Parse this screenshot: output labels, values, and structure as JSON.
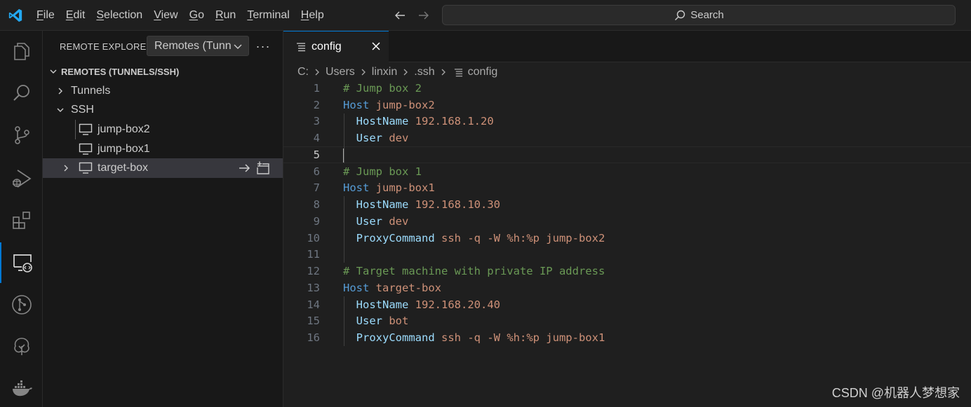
{
  "menu": {
    "items": [
      "File",
      "Edit",
      "Selection",
      "View",
      "Go",
      "Run",
      "Terminal",
      "Help"
    ],
    "mnemonics": [
      "F",
      "E",
      "S",
      "V",
      "G",
      "R",
      "T",
      "H"
    ]
  },
  "search": {
    "label": "Search"
  },
  "activity": {
    "items": [
      "explorer-icon",
      "search-icon",
      "source-control-icon",
      "run-debug-icon",
      "extensions-icon",
      "remote-explorer-icon",
      "git-graph-icon",
      "tree-icon",
      "docker-icon"
    ],
    "active": "remote-explorer-icon",
    "accent": "#0078d4"
  },
  "sidebar": {
    "title": "REMOTE EXPLORER",
    "select_value": "Remotes (Tunnels/SSH)",
    "more": "···",
    "section": "REMOTES (TUNNELS/SSH)",
    "tree": [
      {
        "label": "Tunnels",
        "level": 1,
        "expanded": false
      },
      {
        "label": "SSH",
        "level": 1,
        "expanded": true
      },
      {
        "label": "jump-box2",
        "level": 2
      },
      {
        "label": "jump-box1",
        "level": 2
      },
      {
        "label": "target-box",
        "level": 2,
        "selected": true
      }
    ]
  },
  "editor": {
    "tab": {
      "label": "config"
    },
    "breadcrumb": [
      "C:",
      "Users",
      "linxin",
      ".ssh",
      "config"
    ],
    "current_line": 5,
    "lines": [
      {
        "n": "1",
        "parts": [
          {
            "t": "# Jump box 2",
            "c": "c"
          }
        ]
      },
      {
        "n": "2",
        "parts": [
          {
            "t": "Host",
            "c": "h"
          },
          {
            "t": " "
          },
          {
            "t": "jump-box2",
            "c": "v"
          }
        ]
      },
      {
        "n": "3",
        "parts": [
          {
            "t": "  "
          },
          {
            "t": "HostName",
            "c": "k"
          },
          {
            "t": " "
          },
          {
            "t": "192.168.1.20",
            "c": "v"
          }
        ]
      },
      {
        "n": "4",
        "parts": [
          {
            "t": "  "
          },
          {
            "t": "User",
            "c": "k"
          },
          {
            "t": " "
          },
          {
            "t": "dev",
            "c": "v"
          }
        ]
      },
      {
        "n": "5",
        "parts": []
      },
      {
        "n": "6",
        "parts": [
          {
            "t": "# Jump box 1",
            "c": "c"
          }
        ]
      },
      {
        "n": "7",
        "parts": [
          {
            "t": "Host",
            "c": "h"
          },
          {
            "t": " "
          },
          {
            "t": "jump-box1",
            "c": "v"
          }
        ]
      },
      {
        "n": "8",
        "parts": [
          {
            "t": "  "
          },
          {
            "t": "HostName",
            "c": "k"
          },
          {
            "t": " "
          },
          {
            "t": "192.168.10.30",
            "c": "v"
          }
        ]
      },
      {
        "n": "9",
        "parts": [
          {
            "t": "  "
          },
          {
            "t": "User",
            "c": "k"
          },
          {
            "t": " "
          },
          {
            "t": "dev",
            "c": "v"
          }
        ]
      },
      {
        "n": "10",
        "parts": [
          {
            "t": "  "
          },
          {
            "t": "ProxyCommand",
            "c": "k"
          },
          {
            "t": " "
          },
          {
            "t": "ssh -q -W %h:%p jump-box2",
            "c": "v"
          }
        ]
      },
      {
        "n": "11",
        "parts": []
      },
      {
        "n": "12",
        "parts": [
          {
            "t": "# Target machine with private IP address",
            "c": "c"
          }
        ]
      },
      {
        "n": "13",
        "parts": [
          {
            "t": "Host",
            "c": "h"
          },
          {
            "t": " "
          },
          {
            "t": "target-box",
            "c": "v"
          }
        ]
      },
      {
        "n": "14",
        "parts": [
          {
            "t": "  "
          },
          {
            "t": "HostName",
            "c": "k"
          },
          {
            "t": " "
          },
          {
            "t": "192.168.20.40",
            "c": "v"
          }
        ]
      },
      {
        "n": "15",
        "parts": [
          {
            "t": "  "
          },
          {
            "t": "User",
            "c": "k"
          },
          {
            "t": " "
          },
          {
            "t": "bot",
            "c": "v"
          }
        ]
      },
      {
        "n": "16",
        "parts": [
          {
            "t": "  "
          },
          {
            "t": "ProxyCommand",
            "c": "k"
          },
          {
            "t": " "
          },
          {
            "t": "ssh -q -W %h:%p jump-box1",
            "c": "v"
          }
        ]
      }
    ]
  },
  "watermark": "CSDN @机器人梦想家"
}
